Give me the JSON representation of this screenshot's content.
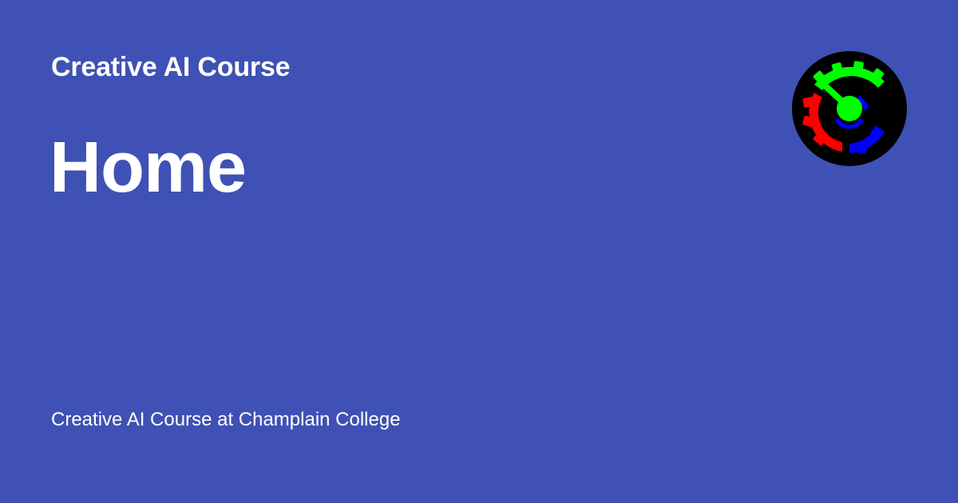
{
  "card": {
    "site_name": "Creative AI Course",
    "page_title": "Home",
    "description": "Creative AI Course at Champlain College"
  },
  "logo": {
    "icon": "gear-logo-icon",
    "colors": {
      "background": "#000000",
      "top_gear": "#00ff00",
      "left_gear": "#ff0000",
      "bottom_gear": "#0000ff",
      "hub": "#00ff00"
    }
  },
  "colors": {
    "page_background": "#3f51b5",
    "text": "#ffffff"
  }
}
